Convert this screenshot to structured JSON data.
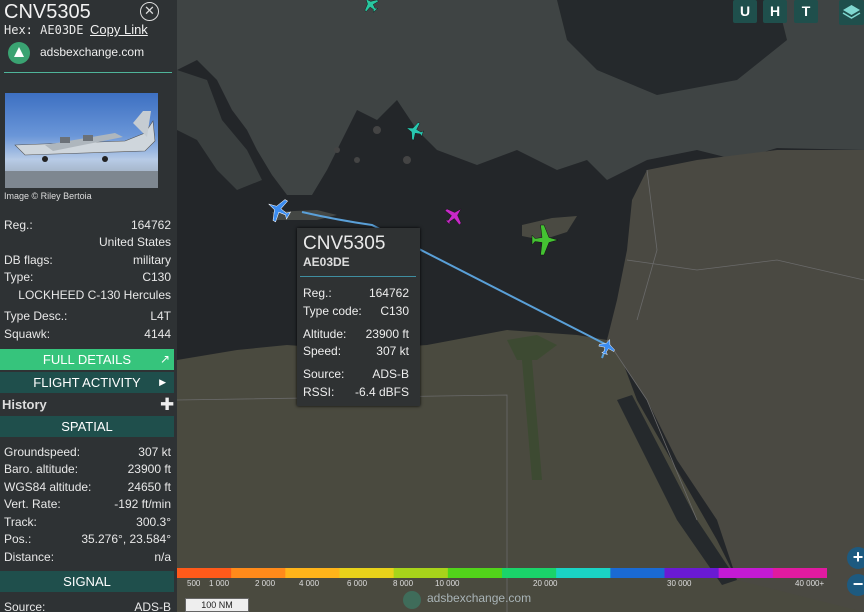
{
  "aircraft": {
    "callsign": "CNV5305",
    "hex_label": "Hex:",
    "hex": "AE03DE",
    "copy_link": "Copy Link",
    "site": "adsbexchange.com",
    "image_credit": "Image © Riley Bertoia"
  },
  "details": {
    "reg_label": "Reg.:",
    "reg": "164762",
    "country": "United States",
    "db_flags_label": "DB flags:",
    "db_flags": "military",
    "type_label": "Type:",
    "type": "C130",
    "type_full": "LOCKHEED C-130 Hercules",
    "type_desc_label": "Type Desc.:",
    "type_desc": "L4T",
    "squawk_label": "Squawk:",
    "squawk": "4144"
  },
  "buttons": {
    "full_details": "FULL DETAILS",
    "flight_activity": "FLIGHT ACTIVITY",
    "history": "History"
  },
  "spatial": {
    "header": "SPATIAL",
    "groundspeed_label": "Groundspeed:",
    "groundspeed": "307 kt",
    "baro_label": "Baro. altitude:",
    "baro": "23900 ft",
    "wgs_label": "WGS84 altitude:",
    "wgs": "24650 ft",
    "vrate_label": "Vert. Rate:",
    "vrate": "-192 ft/min",
    "track_label": "Track:",
    "track": "300.3°",
    "pos_label": "Pos.:",
    "pos": "35.276°, 23.584°",
    "distance_label": "Distance:",
    "distance": "n/a"
  },
  "signal": {
    "header": "SIGNAL",
    "source_label": "Source:",
    "source": "ADS-B"
  },
  "map_controls": {
    "u": "U",
    "h": "H",
    "t": "T"
  },
  "popup": {
    "callsign": "CNV5305",
    "hex": "AE03DE",
    "reg_label": "Reg.:",
    "reg": "164762",
    "type_code_label": "Type code:",
    "type_code": "C130",
    "altitude_label": "Altitude:",
    "altitude": "23900 ft",
    "speed_label": "Speed:",
    "speed": "307 kt",
    "source_label": "Source:",
    "source": "ADS-B",
    "rssi_label": "RSSI:",
    "rssi": "-6.4 dBFS"
  },
  "legend": {
    "labels": [
      "500",
      "1 000",
      "2 000",
      "4 000",
      "6 000",
      "8 000",
      "10 000",
      "20 000",
      "30 000",
      "40 000+"
    ],
    "colors": [
      "#ff5a1a",
      "#ff8a1a",
      "#ffb41a",
      "#e8d21a",
      "#a8d41a",
      "#52d41a",
      "#1ad46a",
      "#1ad4c4",
      "#1a6ad4",
      "#6a1ad4",
      "#c41ad4",
      "#e01aa0"
    ]
  },
  "scale": "100 NM",
  "footer": "adsbexchange.com",
  "zoom": {
    "in": "+",
    "out": "−"
  }
}
